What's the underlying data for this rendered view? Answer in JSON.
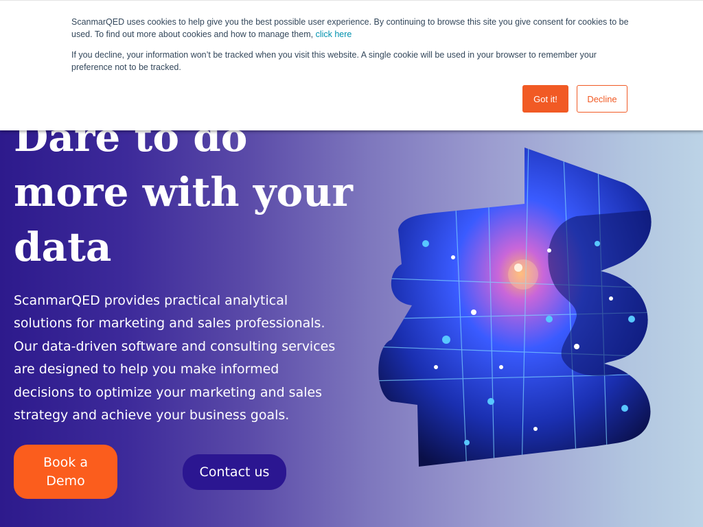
{
  "hero": {
    "headline_line1": "Dare to do",
    "headline_line2": "more with your",
    "headline_line3": "data",
    "lead": "ScanmarQED provides practical analytical solutions for marketing and sales professionals. Our data-driven software and consulting services are designed to help you make informed decisions to optimize your marketing and sales strategy and achieve your business goals.",
    "book_demo_label": "Book a Demo",
    "contact_label": "Contact us"
  },
  "cookie_banner": {
    "text1": "ScanmarQED uses cookies to help give you the best possible user experience. By continuing to browse this site you give consent for cookies to be used. To find out more about cookies and how to manage them,",
    "link_label": "click here",
    "text2": "If you decline, your information won’t be tracked when you visit this website. A single cookie will be used in your browser to remember your preference not to be tracked.",
    "accept_label": "Got it!",
    "decline_label": "Decline"
  },
  "colors": {
    "brand_orange": "#fb5d1d",
    "brand_indigo": "#2b1691",
    "link": "#0091ae"
  },
  "icons": {
    "hero_art": "digital-face-brand-shape"
  }
}
